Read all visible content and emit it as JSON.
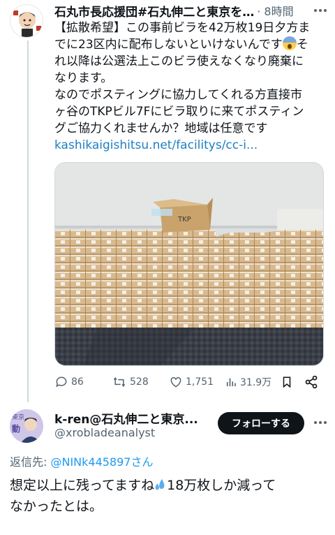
{
  "tweet": {
    "author_name": "石丸市長応援団#石丸伸二と東京を…",
    "time": "· 8時間",
    "text_lines": [
      "【拡散希望】この事前ビラを42万枚19日夕方ま",
      "でに23区内に配布しないといけないんです",
      "れ以降は公選法上このビラ使えなくなり廃棄に",
      "なります。",
      "なのでポスティングに協力してくれる方直接市",
      "ヶ谷のTKPビル7Fにビラ取りに来てポスティン",
      "グご協力くれませんか？地域は任意です"
    ],
    "text_after_emoji": "そ",
    "link": "kashikaigishitsu.net/facilitys/cc-i...",
    "box_label": "TKP",
    "stats": {
      "replies": "86",
      "retweets": "528",
      "likes": "1,751",
      "views": "31.9万"
    }
  },
  "reply": {
    "author_name": "k-ren@石丸伸二と東京...",
    "handle": "@xrobladeanalyst",
    "follow_label": "フォローする",
    "replying_prefix": "返信先: ",
    "replying_to": "@NINk445897さん",
    "text_line1_before": "想定以上に残ってますね",
    "text_line1_after": "18万枚しか減って",
    "text_line2": "なかったとは。"
  },
  "icons": [
    "more-icon",
    "reply-icon",
    "retweet-icon",
    "like-icon",
    "views-icon",
    "bookmark-icon",
    "share-icon",
    "scream-emoji",
    "sweat-emoji"
  ],
  "colors": {
    "text": "#0f1419",
    "secondary": "#536471",
    "link": "#1d9bf0",
    "follow_bg": "#0f1419"
  }
}
